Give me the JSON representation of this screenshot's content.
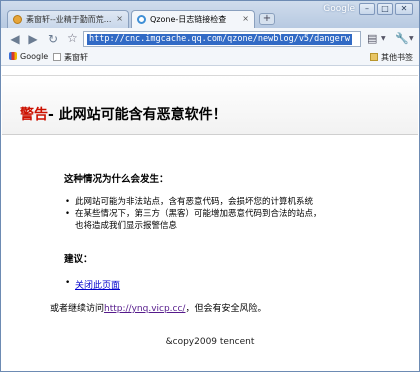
{
  "window": {
    "google_label": "Google",
    "minimize": "–",
    "maximize": "□",
    "close": "✕"
  },
  "tabs": [
    {
      "label": "素窗轩--业精于勤而荒...",
      "close": "×"
    },
    {
      "label": "Qzone-日志链接检查",
      "close": "×"
    }
  ],
  "new_tab": "+",
  "toolbar": {
    "back": "◀",
    "forward": "▶",
    "reload": "↻",
    "star": "☆",
    "url": "http://cnc.imgcache.qq.com/qzone/newblog/v5/dangerw",
    "page_menu_icon": "▤",
    "wrench_icon": "🔧",
    "caret": "▼"
  },
  "bookmarks": {
    "items": [
      "Google",
      "素窗轩"
    ],
    "other": "其他书签"
  },
  "page": {
    "warning_red": "警告",
    "warning_rest": "- 此网站可能含有恶意软件！",
    "why_heading": "这种情况为什么会发生：",
    "reasons": [
      "此网站可能为非法站点，含有恶意代码，会损坏您的计算机系统",
      "在某些情况下，第三方（黑客）可能增加恶意代码到合法的站点，",
      "也将造成我们显示报警信息"
    ],
    "advice_heading": "建议：",
    "close_page_link": "关闭此页面",
    "continue_prefix": "或者继续访问",
    "continue_link": "http://ynq.vicp.cc/",
    "continue_suffix": "，但会有安全风险。",
    "footer": "&copy2009 tencent"
  }
}
